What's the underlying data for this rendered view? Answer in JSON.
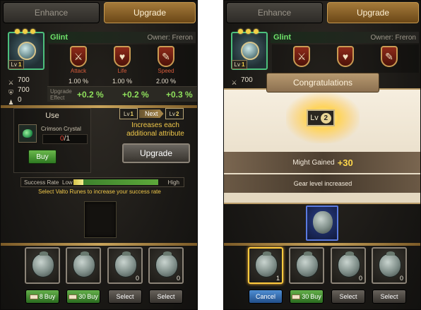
{
  "tabs": {
    "enhance": "Enhance",
    "upgrade": "Upgrade"
  },
  "item": {
    "name": "Glint",
    "owner": "Owner: Freron",
    "level_prefix": "Lv",
    "level": "1",
    "stats": [
      "700",
      "700",
      "0"
    ]
  },
  "attributes": [
    {
      "label": "Attack",
      "icon": "crossed-swords-icon",
      "pct": "1.00 %",
      "effect": "+0.2 %"
    },
    {
      "label": "Life",
      "icon": "heart-icon",
      "pct": "1.00 %",
      "effect": "+0.2 %"
    },
    {
      "label": "Speed",
      "icon": "feather-icon",
      "pct": "2.00 %",
      "effect": "+0.3 %"
    }
  ],
  "effect_label": "Upgrade Effect",
  "use": {
    "title": "Use",
    "crystal_name": "Crimson Crystal",
    "owned": "0",
    "required": "/1",
    "buy": "Buy"
  },
  "next": {
    "from": "1",
    "label": "Next",
    "to": "2",
    "desc": "Increases each additional attribute"
  },
  "upgrade_button": "Upgrade",
  "success": {
    "label": "Success Rate",
    "low": "Low",
    "high": "High",
    "level": 0.12,
    "hint": "Select Valto Runes to increase your success rate"
  },
  "runes_left": [
    {
      "count": "",
      "button": "Buy",
      "cost": "8",
      "style": "green"
    },
    {
      "count": "",
      "button": "Buy",
      "cost": "30",
      "style": "green"
    },
    {
      "count": "0",
      "button": "Select",
      "cost": "",
      "style": "gray"
    },
    {
      "count": "0",
      "button": "Select",
      "cost": "",
      "style": "gray"
    }
  ],
  "right": {
    "stat": "700",
    "congrats_title": "Congratulations",
    "level": "2",
    "might_label": "Might Gained",
    "might_value": "+30",
    "gear_msg": "Gear level increased",
    "runes": [
      {
        "count": "1",
        "button": "Cancel",
        "cost": "",
        "style": "blue",
        "selected": true
      },
      {
        "count": "",
        "button": "Buy",
        "cost": "30",
        "style": "green",
        "selected": false
      },
      {
        "count": "0",
        "button": "Select",
        "cost": "",
        "style": "gray",
        "selected": false
      },
      {
        "count": "0",
        "button": "Select",
        "cost": "",
        "style": "gray",
        "selected": false
      }
    ]
  }
}
